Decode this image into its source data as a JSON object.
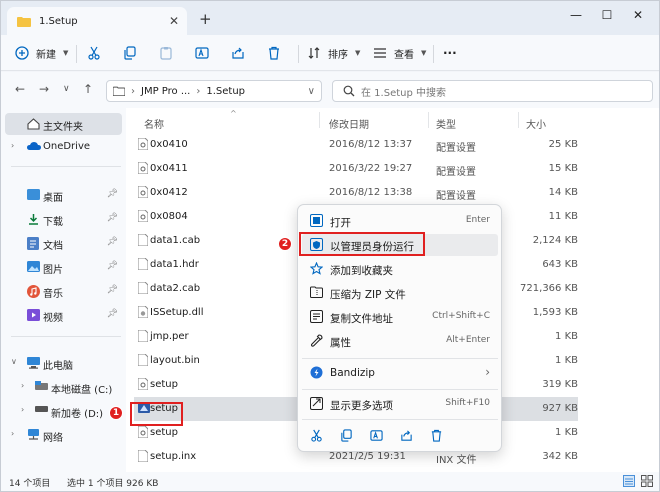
{
  "window": {
    "tab_title": "1.Setup",
    "tab_close": "✕",
    "new_tab": "+",
    "min": "—",
    "max": "☐",
    "close": "✕"
  },
  "toolbar": {
    "new_label": "新建",
    "sort_label": "排序",
    "view_label": "查看",
    "more_label": "···"
  },
  "address": {
    "path_1": "JMP Pro ...",
    "path_sep": "›",
    "path_2": "1.Setup",
    "search_placeholder": "在 1.Setup 中搜索"
  },
  "sidebar": {
    "home": "主文件夹",
    "onedrive": "OneDrive",
    "desktop": "桌面",
    "downloads": "下载",
    "documents": "文档",
    "pictures": "图片",
    "music": "音乐",
    "videos": "视频",
    "thispc": "此电脑",
    "drive_c": "本地磁盘 (C:)",
    "drive_d": "新加卷 (D:)",
    "network": "网络"
  },
  "columns": {
    "name": "名称",
    "date": "修改日期",
    "type": "类型",
    "size": "大小"
  },
  "files": [
    {
      "name": "0x0410",
      "date": "2016/8/12 13:37",
      "type": "配置设置",
      "size": "25 KB"
    },
    {
      "name": "0x0411",
      "date": "2016/3/22 19:27",
      "type": "配置设置",
      "size": "15 KB"
    },
    {
      "name": "0x0412",
      "date": "2016/8/12 13:38",
      "type": "配置设置",
      "size": "14 KB"
    },
    {
      "name": "0x0804",
      "date": "",
      "type": "",
      "size": "11 KB"
    },
    {
      "name": "data1.cab",
      "date": "",
      "type": "",
      "size": "2,124 KB"
    },
    {
      "name": "data1.hdr",
      "date": "",
      "type": "",
      "size": "643 KB"
    },
    {
      "name": "data2.cab",
      "date": "",
      "type": "",
      "size": "721,366 KB"
    },
    {
      "name": "ISSetup.dll",
      "date": "",
      "type": "",
      "size": "1,593 KB"
    },
    {
      "name": "jmp.per",
      "date": "",
      "type": "",
      "size": "1 KB"
    },
    {
      "name": "layout.bin",
      "date": "",
      "type": "",
      "size": "1 KB"
    },
    {
      "name": "setup",
      "date": "",
      "type": "",
      "size": "319 KB"
    },
    {
      "name": "setup",
      "date": "",
      "type": "",
      "size": "927 KB"
    },
    {
      "name": "setup",
      "date": "",
      "type": "",
      "size": "1 KB"
    },
    {
      "name": "setup.inx",
      "date": "2021/2/5 19:31",
      "type": "INX 文件",
      "size": "342 KB"
    }
  ],
  "context_menu": {
    "open": "打开",
    "open_sc": "Enter",
    "runas": "以管理员身份运行",
    "favorite": "添加到收藏夹",
    "zip": "压缩为 ZIP 文件",
    "copypath": "复制文件地址",
    "copypath_sc": "Ctrl+Shift+C",
    "props": "属性",
    "props_sc": "Alt+Enter",
    "bandizip": "Bandizip",
    "bandizip_arrow": "›",
    "more": "显示更多选项",
    "more_sc": "Shift+F10"
  },
  "annotations": {
    "badge1": "1",
    "badge2": "2"
  },
  "status": {
    "count": "14 个项目",
    "selected": "选中 1 个项目  926 KB"
  },
  "colors": {
    "accent": "#0067c0",
    "folder": "#f5c342",
    "annotation": "#e02020"
  }
}
